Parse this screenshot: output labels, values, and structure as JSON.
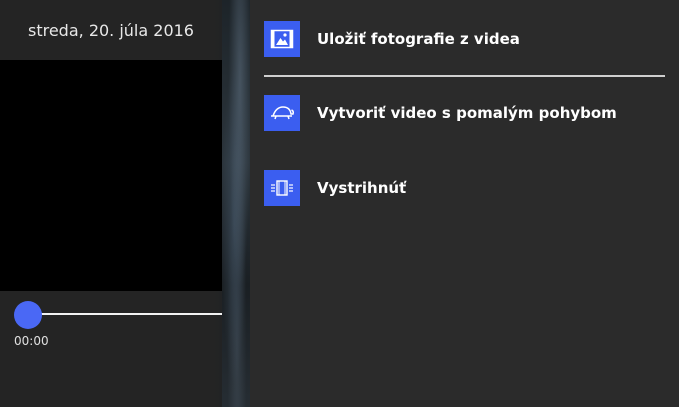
{
  "video": {
    "date_title": "streda, 20. júla 2016",
    "current_time": "00:00"
  },
  "menu": {
    "items": [
      {
        "label": "Uložiť fotografie z videa",
        "icon": "photos-from-video-icon"
      },
      {
        "label": "Vytvoriť video s pomalým pohybom",
        "icon": "turtle-slow-motion-icon"
      },
      {
        "label": "Vystrihnúť",
        "icon": "trim-icon"
      }
    ]
  },
  "colors": {
    "accent": "#3b5ef0",
    "seek_thumb": "#4a68f5",
    "flyout_bg": "#2b2b2b",
    "text": "#ffffff"
  }
}
